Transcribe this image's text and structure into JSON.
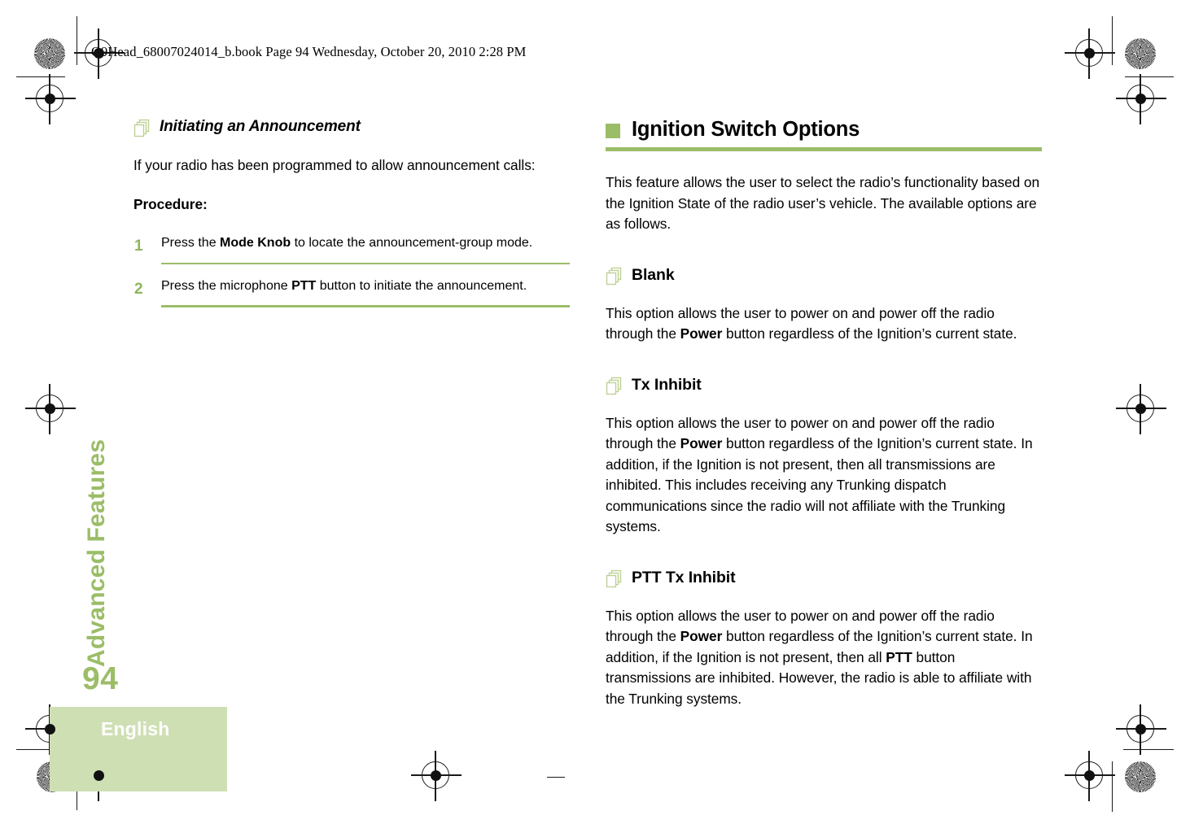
{
  "document": {
    "header_line": "O9Head_68007024014_b.book  Page 94  Wednesday, October 20, 2010  2:28 PM",
    "chapter_tab": "Advanced Features",
    "page_number": "94",
    "language": "English",
    "accent_color": "#9bbd68",
    "band_color": "#cfdfb4"
  },
  "left_column": {
    "section_heading": "Initiating an Announcement",
    "section_icon": "stacked-pages-icon",
    "intro": "If your radio has been programmed to allow announcement calls:",
    "procedure_label": "Procedure:",
    "steps": [
      {
        "number": "1",
        "text_parts": [
          {
            "text": "Press the ",
            "bold": false
          },
          {
            "text": "Mode Knob",
            "bold": true
          },
          {
            "text": " to locate the announcement-group mode.",
            "bold": false
          }
        ]
      },
      {
        "number": "2",
        "text_parts": [
          {
            "text": "Press the microphone ",
            "bold": false
          },
          {
            "text": "PTT",
            "bold": true
          },
          {
            "text": " button to initiate the announcement.",
            "bold": false
          }
        ]
      }
    ]
  },
  "right_column": {
    "title": "Ignition Switch Options",
    "title_icon": "green-square-bullet",
    "intro": "This feature allows the user to select the radio’s functionality based on the Ignition State of the radio user’s vehicle. The available options are as follows.",
    "subsections": [
      {
        "icon": "stacked-pages-icon",
        "heading": "Blank",
        "parts": [
          {
            "text": "This option allows the user to power on and power off the radio through the ",
            "bold": false
          },
          {
            "text": "Power",
            "bold": true
          },
          {
            "text": " button regardless of the Ignition’s current state.",
            "bold": false
          }
        ]
      },
      {
        "icon": "stacked-pages-icon",
        "heading": "Tx Inhibit",
        "parts": [
          {
            "text": "This option allows the user to power on and power off the radio through the ",
            "bold": false
          },
          {
            "text": "Power",
            "bold": true
          },
          {
            "text": " button regardless of the Ignition’s current state. In addition, if the Ignition is not present, then all transmissions are inhibited. This includes receiving any Trunking dispatch communications since the radio will not affiliate with the Trunking systems.",
            "bold": false
          }
        ]
      },
      {
        "icon": "stacked-pages-icon",
        "heading": "PTT Tx Inhibit",
        "parts": [
          {
            "text": "This option allows the user to power on and power off the radio through the ",
            "bold": false
          },
          {
            "text": "Power",
            "bold": true
          },
          {
            "text": " button regardless of the Ignition’s current state. In addition, if the Ignition is not present, then all ",
            "bold": false
          },
          {
            "text": "PTT",
            "bold": true
          },
          {
            "text": " button transmissions are inhibited. However, the radio is able to affiliate with the Trunking systems.",
            "bold": false
          }
        ]
      }
    ]
  }
}
